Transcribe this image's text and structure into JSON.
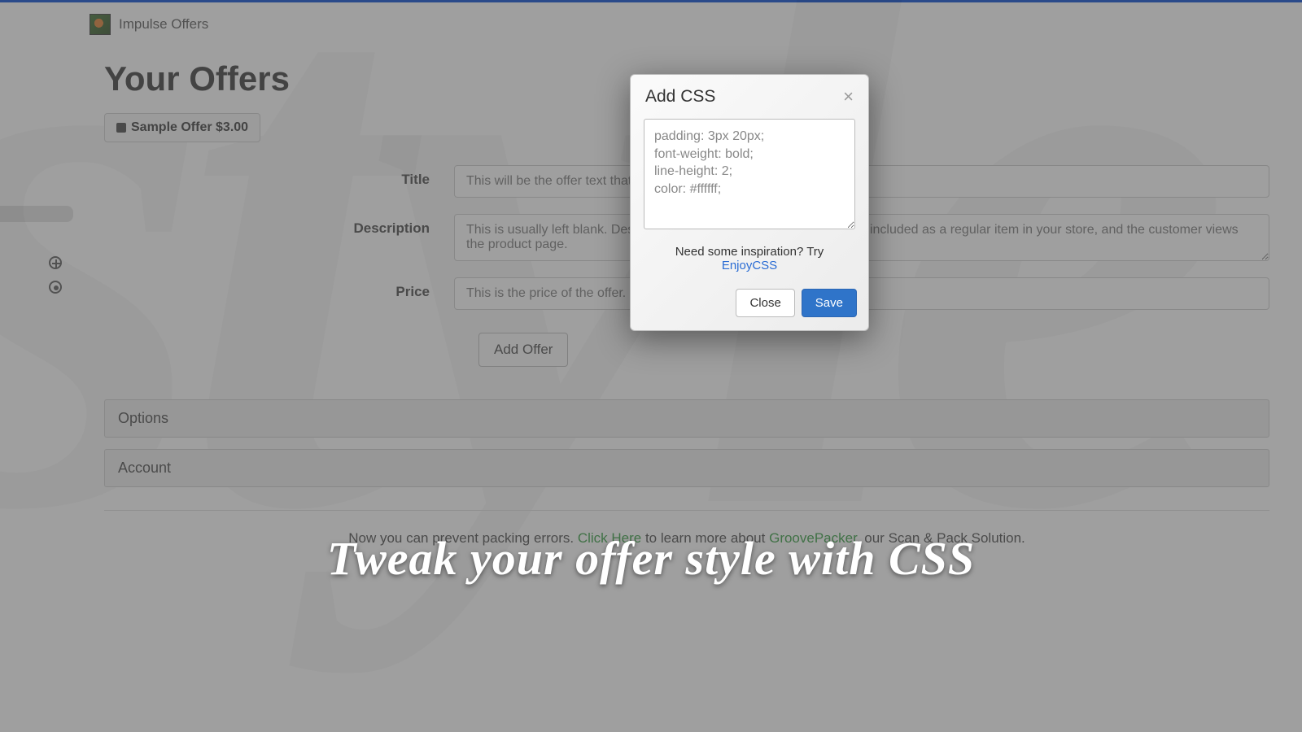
{
  "app": {
    "name": "Impulse Offers"
  },
  "page": {
    "title": "Your Offers"
  },
  "sample_offer": {
    "label": "Sample Offer $3.00"
  },
  "form": {
    "title": {
      "label": "Title",
      "placeholder": "This will be the offer text that will be displayed on the cart page."
    },
    "description": {
      "label": "Description",
      "placeholder": "This is usually left blank. Description is only used if you have the offer included as a regular item in your store, and the customer views the product page."
    },
    "price": {
      "label": "Price",
      "placeholder": "This is the price of the offer."
    },
    "add_button": "Add Offer"
  },
  "sections": {
    "options": "Options",
    "account": "Account"
  },
  "footer": {
    "pre": "Now you can prevent packing errors. ",
    "click": "Click Here",
    "mid": " to learn more about ",
    "brand": "GroovePacker",
    "post": ", our Scan & Pack Solution."
  },
  "modal": {
    "title": "Add CSS",
    "css_value": "padding: 3px 20px;\nfont-weight: bold;\nline-height: 2;\ncolor: #ffffff;",
    "hint_pre": "Need some inspiration? Try",
    "hint_link": "EnjoyCSS",
    "close": "Close",
    "save": "Save"
  },
  "tagline": "Tweak your offer style with CSS"
}
